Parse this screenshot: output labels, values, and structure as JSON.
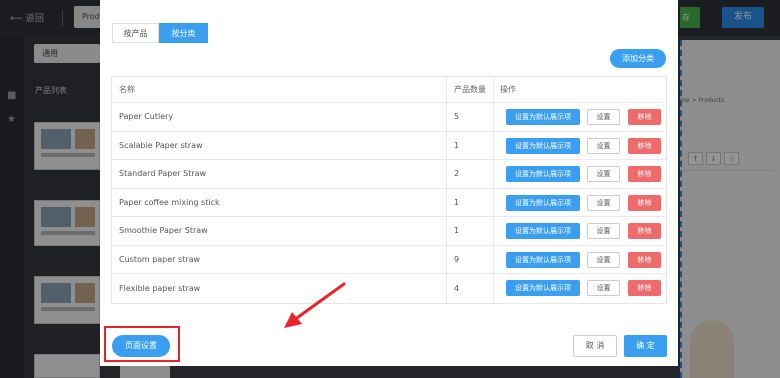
{
  "topbar": {
    "back_label": "返回",
    "product_chip": "Prod",
    "save_partial": "存",
    "publish_label": "发布"
  },
  "sidebar": {
    "select_value": "通用",
    "list_title": "产品列表"
  },
  "canvas": {
    "breadcrumb": "me > Products"
  },
  "modal": {
    "tabs": [
      {
        "label": "按产品",
        "active": false
      },
      {
        "label": "按分类",
        "active": true
      }
    ],
    "add_button": "添加分类",
    "table": {
      "headers": {
        "name": "名称",
        "count": "产品数量",
        "ops": "操作"
      },
      "rows": [
        {
          "name": "Paper Cutlery",
          "count": "5"
        },
        {
          "name": "Scalable Paper straw",
          "count": "1"
        },
        {
          "name": "Standard Paper Straw",
          "count": "2"
        },
        {
          "name": "Paper coffee mixing stick",
          "count": "1"
        },
        {
          "name": "Smoothie Paper Straw",
          "count": "1"
        },
        {
          "name": "Custom paper straw",
          "count": "9"
        },
        {
          "name": "Flexible paper straw",
          "count": "4"
        }
      ],
      "row_buttons": {
        "default_label": "设置为默认展示项",
        "set_label": "设置",
        "remove_label": "移除"
      }
    },
    "page_settings_button": "页面设置",
    "cancel_button": "取 消",
    "confirm_button": "确 定"
  },
  "colors": {
    "primary": "#3a9ff0",
    "danger": "#ee6b6b",
    "highlight": "#e8242a",
    "publish": "#2d8df0",
    "save": "#49b94f"
  }
}
